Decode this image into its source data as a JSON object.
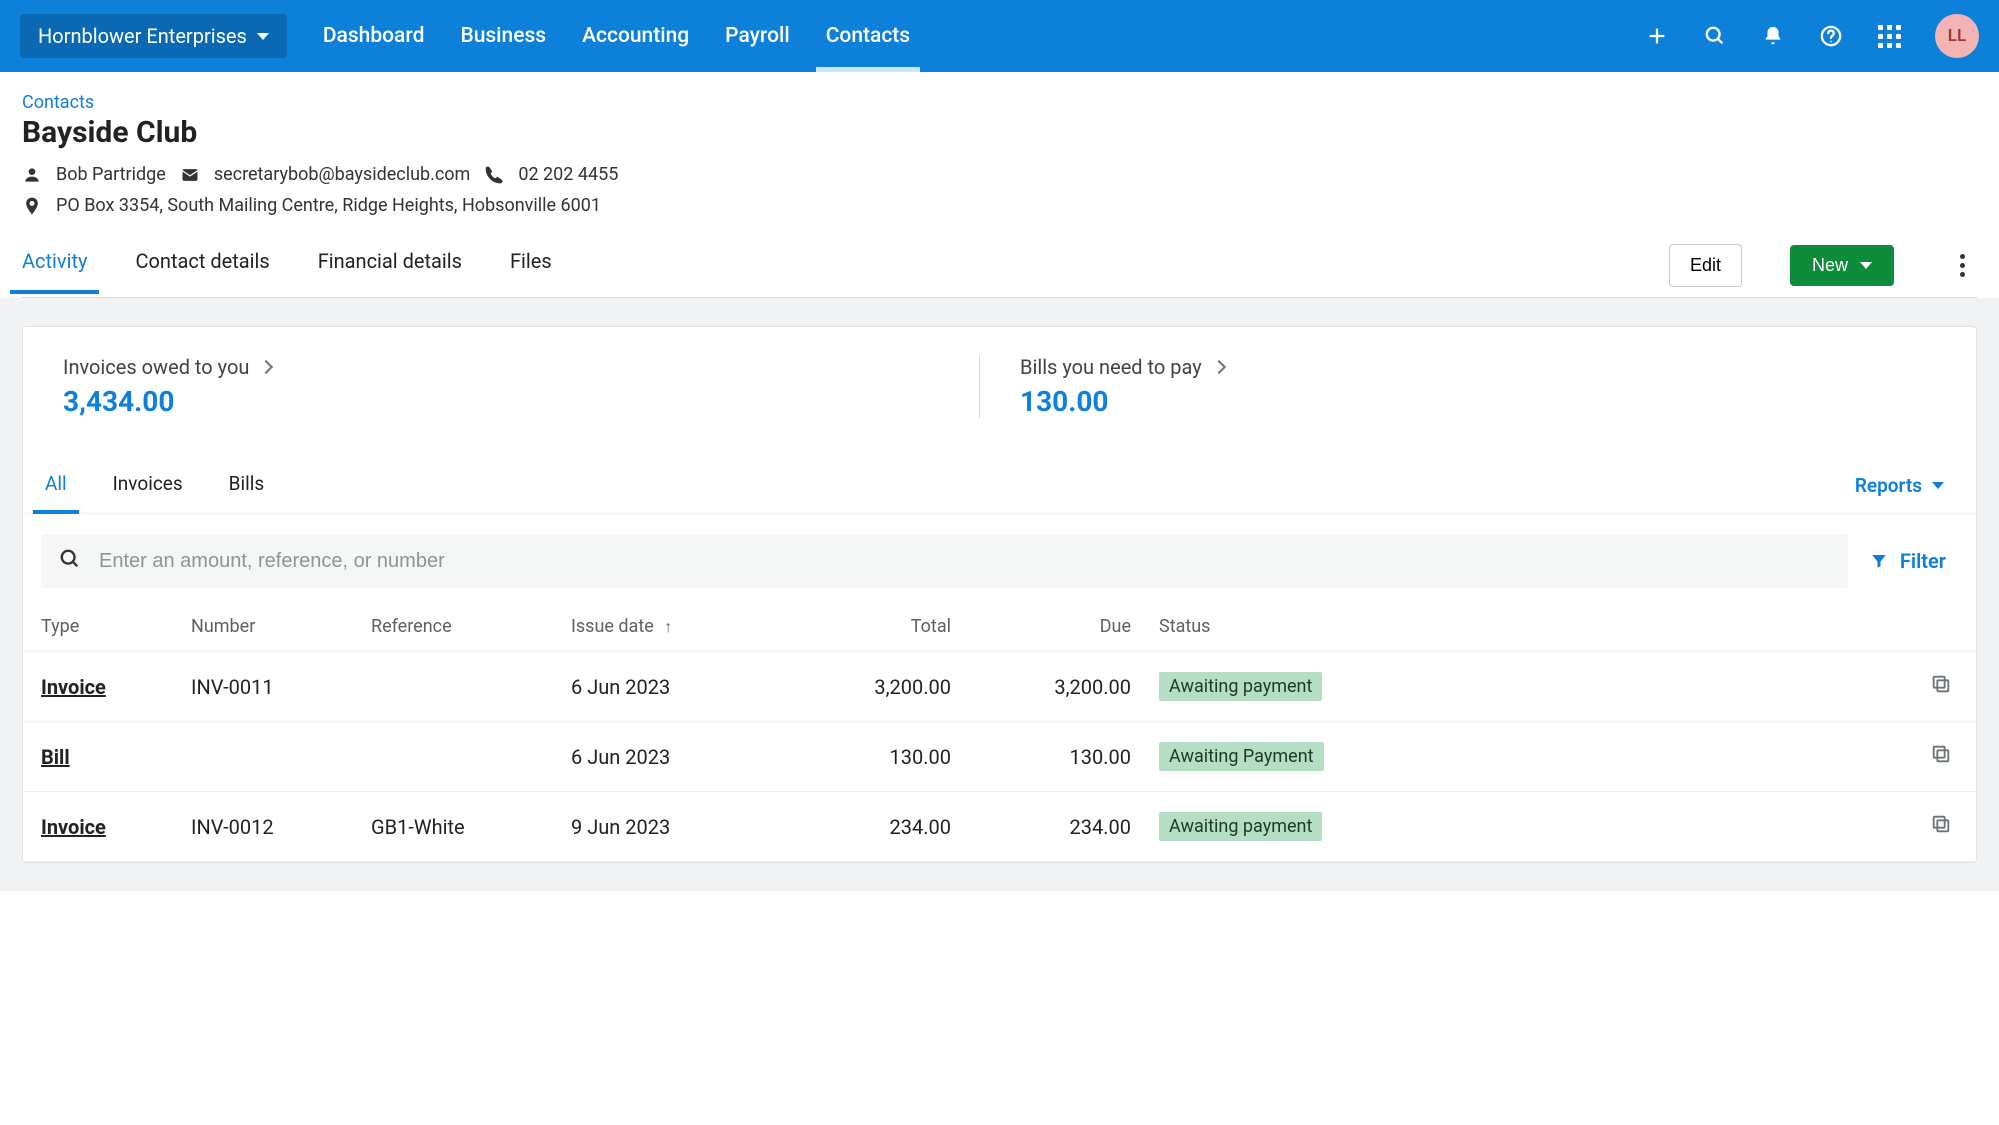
{
  "topbar": {
    "org_name": "Hornblower Enterprises",
    "nav": [
      "Dashboard",
      "Business",
      "Accounting",
      "Payroll",
      "Contacts"
    ],
    "active_nav_index": 4,
    "avatar_initials": "LL"
  },
  "breadcrumb": "Contacts",
  "page_title": "Bayside Club",
  "contact": {
    "person": "Bob Partridge",
    "email": "secretarybob@baysideclub.com",
    "phone": "02 202 4455",
    "address": "PO Box 3354, South Mailing Centre, Ridge Heights, Hobsonville 6001"
  },
  "tabs": [
    "Activity",
    "Contact details",
    "Financial details",
    "Files"
  ],
  "active_tab_index": 0,
  "buttons": {
    "edit": "Edit",
    "new": "New"
  },
  "summary": {
    "invoices_label": "Invoices owed to you",
    "invoices_value": "3,434.00",
    "bills_label": "Bills you need to pay",
    "bills_value": "130.00"
  },
  "subtabs": [
    "All",
    "Invoices",
    "Bills"
  ],
  "active_subtab_index": 0,
  "reports_label": "Reports",
  "search": {
    "placeholder": "Enter an amount, reference, or number"
  },
  "filter_label": "Filter",
  "columns": {
    "type": "Type",
    "number": "Number",
    "reference": "Reference",
    "issue_date": "Issue date",
    "total": "Total",
    "due": "Due",
    "status": "Status"
  },
  "rows": [
    {
      "type": "Invoice",
      "number": "INV-0011",
      "reference": "",
      "issue_date": "6 Jun 2023",
      "total": "3,200.00",
      "due": "3,200.00",
      "status": "Awaiting payment"
    },
    {
      "type": "Bill",
      "number": "",
      "reference": "",
      "issue_date": "6 Jun 2023",
      "total": "130.00",
      "due": "130.00",
      "status": "Awaiting Payment"
    },
    {
      "type": "Invoice",
      "number": "INV-0012",
      "reference": "GB1-White",
      "issue_date": "9 Jun 2023",
      "total": "234.00",
      "due": "234.00",
      "status": "Awaiting payment"
    }
  ]
}
